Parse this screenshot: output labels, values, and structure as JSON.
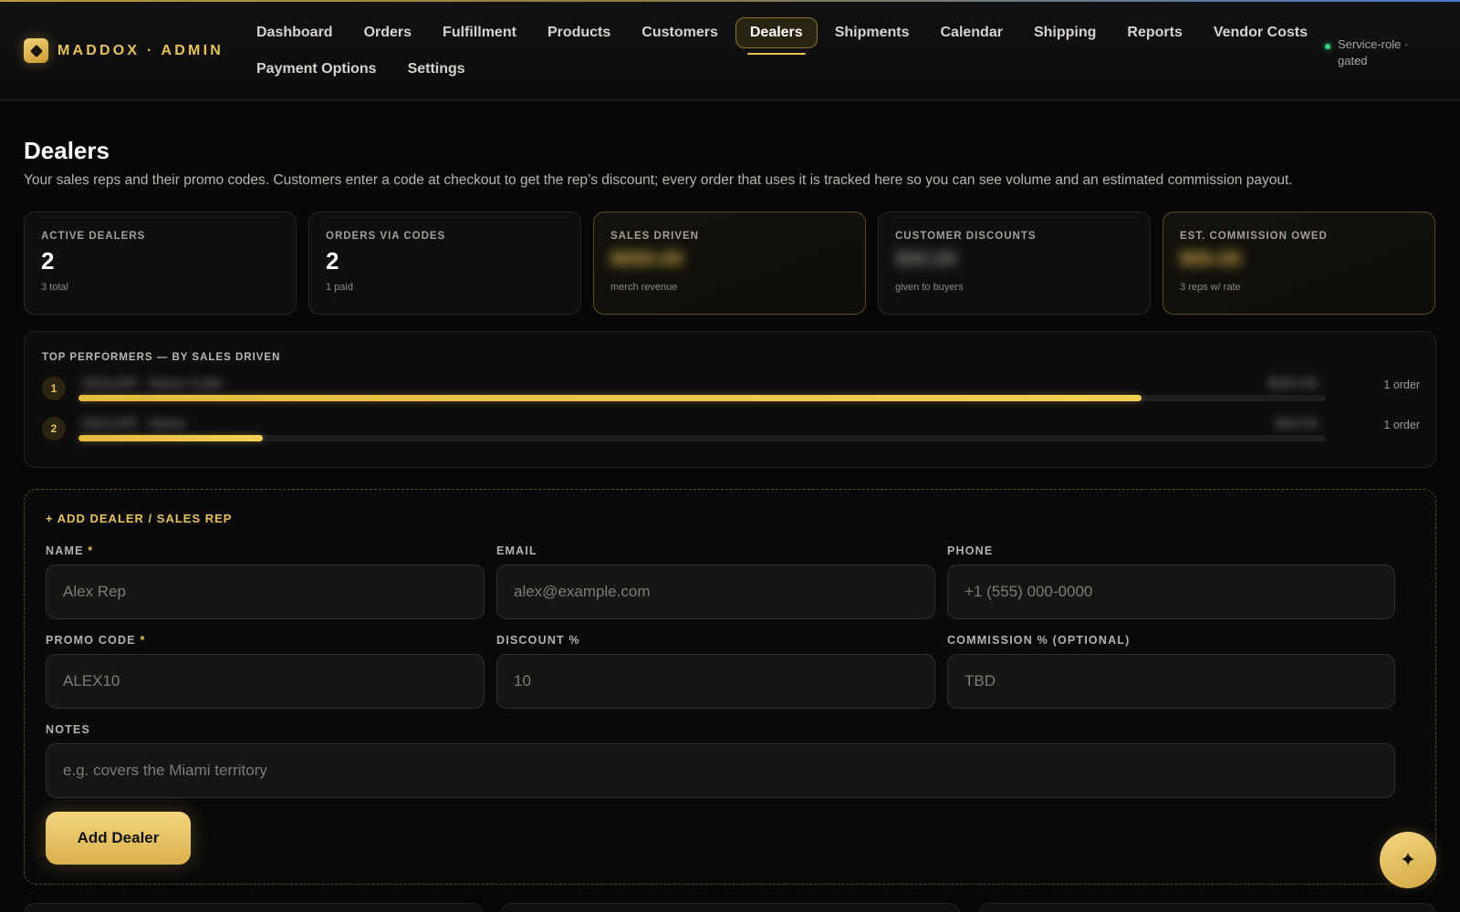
{
  "brand": {
    "name": "MADDOX · ADMIN",
    "logo_icon": "diamond-icon",
    "accent": "#E7C35A"
  },
  "nav": {
    "row1": [
      "Dashboard",
      "Orders",
      "Fulfillment",
      "Products",
      "Customers",
      "Dealers",
      "Shipments",
      "Calendar",
      "Shipping",
      "Reports",
      "Vendor Costs"
    ],
    "row2": [
      "Payment Options",
      "Settings"
    ],
    "active": "Dealers"
  },
  "service_status": {
    "text": "Service-role · gated",
    "color": "#3AD48B"
  },
  "page": {
    "title": "Dealers",
    "description": "Your sales reps and their promo codes. Customers enter a code at checkout to get the rep’s discount; every order that uses it is tracked here so you can see volume and an estimated commission payout."
  },
  "stats": [
    {
      "label": "ACTIVE DEALERS",
      "value": "2",
      "sub": "3 total",
      "highlight": false,
      "blurred": false
    },
    {
      "label": "ORDERS VIA CODES",
      "value": "2",
      "sub": "1 paid",
      "highlight": false,
      "blurred": false
    },
    {
      "label": "SALES DRIVEN",
      "value": "$000.00",
      "sub": "merch revenue",
      "highlight": true,
      "blurred": true
    },
    {
      "label": "CUSTOMER DISCOUNTS",
      "value": "$00.00",
      "sub": "given to buyers",
      "highlight": false,
      "blurred": true
    },
    {
      "label": "EST. COMMISSION OWED",
      "value": "$00.00",
      "sub": "3 reps w/ rate",
      "highlight": true,
      "blurred": true
    }
  ],
  "top_performers": {
    "title": "TOP PERFORMERS — BY SALES DRIVEN",
    "rows": [
      {
        "rank": "1",
        "name": "DEALER · Name Code",
        "amount": "$000.00",
        "orders": "1 order",
        "share": 0.852
      },
      {
        "rank": "2",
        "name": "DEALER · Name",
        "amount": "$00.00",
        "orders": "1 order",
        "share": 0.148
      }
    ]
  },
  "form": {
    "title": "+ ADD DEALER / SALES REP",
    "fields": {
      "name": {
        "label": "NAME",
        "required": "*",
        "placeholder": "Alex Rep"
      },
      "email": {
        "label": "EMAIL",
        "placeholder": "alex@example.com"
      },
      "phone": {
        "label": "PHONE",
        "placeholder": "+1 (555) 000-0000"
      },
      "promo": {
        "label": "PROMO CODE",
        "required": "*",
        "placeholder": "ALEX10"
      },
      "discount": {
        "label": "DISCOUNT %",
        "placeholder": "10"
      },
      "commission": {
        "label": "COMMISSION % (OPTIONAL)",
        "placeholder": "TBD"
      },
      "notes": {
        "label": "NOTES",
        "placeholder": "e.g. covers the Miami territory"
      }
    },
    "submit_label": "Add Dealer"
  },
  "fab": {
    "icon": "sparkle-icon",
    "glyph": "✦"
  }
}
